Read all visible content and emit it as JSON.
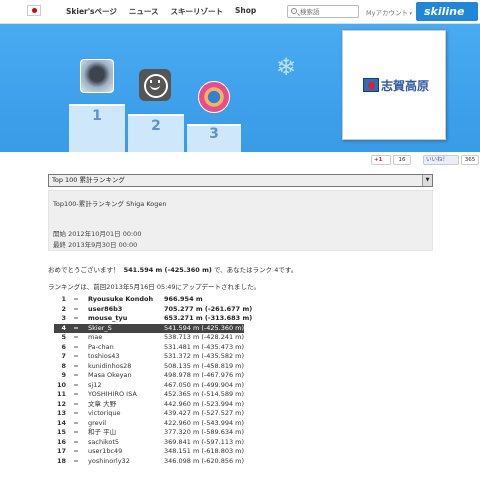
{
  "nav": {
    "items": [
      "Skier'sページ",
      "ニュース",
      "スキーリゾート",
      "Shop"
    ],
    "search_placeholder": "検索語",
    "account": "Myアカウント",
    "logo": "skiline"
  },
  "podium": {
    "positions": [
      "1",
      "2",
      "3"
    ]
  },
  "social": {
    "gplus": "+1",
    "gplus_count": "16",
    "fb_like": "いいね！",
    "fb_count": "365"
  },
  "dropdown": {
    "selected": "Top 100 累計ランキング"
  },
  "info": {
    "title": "Top100-累計ランキング Shiga Kogen",
    "start": "開始 2012年10月01日 00:00",
    "end": "最終 2013年9月30日 00:00"
  },
  "message": {
    "prefix": "おめでとうございます！",
    "highlight": "541.594 m (-425.360 m)",
    "suffix": "で、あなたはランク 4です。",
    "updated": "ランキングは、前回2013年5月16日 05:49にアップデートされました。"
  },
  "ranking": [
    {
      "rank": "1",
      "change": "=",
      "name": "Ryousuke Kondoh",
      "distance": "966.954 m"
    },
    {
      "rank": "2",
      "change": "=",
      "name": "user86b3",
      "distance": "705.277 m (-261.677 m)"
    },
    {
      "rank": "3",
      "change": "=",
      "name": "mouse_tyu",
      "distance": "653.271 m (-313.683 m)"
    },
    {
      "rank": "4",
      "change": "=",
      "name": "Skier_S",
      "distance": "541.594 m (-425.360 m)"
    },
    {
      "rank": "5",
      "change": "=",
      "name": "mae",
      "distance": "538.713 m (-428.241 m)"
    },
    {
      "rank": "6",
      "change": "=",
      "name": "Pa-chan",
      "distance": "531.481 m (-435.473 m)"
    },
    {
      "rank": "7",
      "change": "=",
      "name": "toshios43",
      "distance": "531.372 m (-435.582 m)"
    },
    {
      "rank": "8",
      "change": "=",
      "name": "kunidinhos28",
      "distance": "508.135 m (-458.819 m)"
    },
    {
      "rank": "9",
      "change": "=",
      "name": "Masa Okeyan",
      "distance": "498.978 m (-467.976 m)"
    },
    {
      "rank": "10",
      "change": "=",
      "name": "sj12",
      "distance": "467.050 m (-499.904 m)"
    },
    {
      "rank": "11",
      "change": "=",
      "name": "YOSHIHIRO ISA",
      "distance": "452.365 m (-514.589 m)"
    },
    {
      "rank": "12",
      "change": "=",
      "name": "文章 大野",
      "distance": "442.960 m (-523.994 m)"
    },
    {
      "rank": "13",
      "change": "=",
      "name": "victorique",
      "distance": "439.427 m (-527.527 m)"
    },
    {
      "rank": "14",
      "change": "=",
      "name": "grevil",
      "distance": "422.960 m (-543.994 m)"
    },
    {
      "rank": "15",
      "change": "=",
      "name": "和子 平山",
      "distance": "377.320 m (-589.634 m)"
    },
    {
      "rank": "16",
      "change": "=",
      "name": "sachikot5",
      "distance": "369.841 m (-597.113 m)"
    },
    {
      "rank": "17",
      "change": "=",
      "name": "user1bc49",
      "distance": "348.151 m (-618.803 m)"
    },
    {
      "rank": "18",
      "change": "=",
      "name": "yoshinorly32",
      "distance": "346.098 m (-620.856 m)"
    }
  ]
}
